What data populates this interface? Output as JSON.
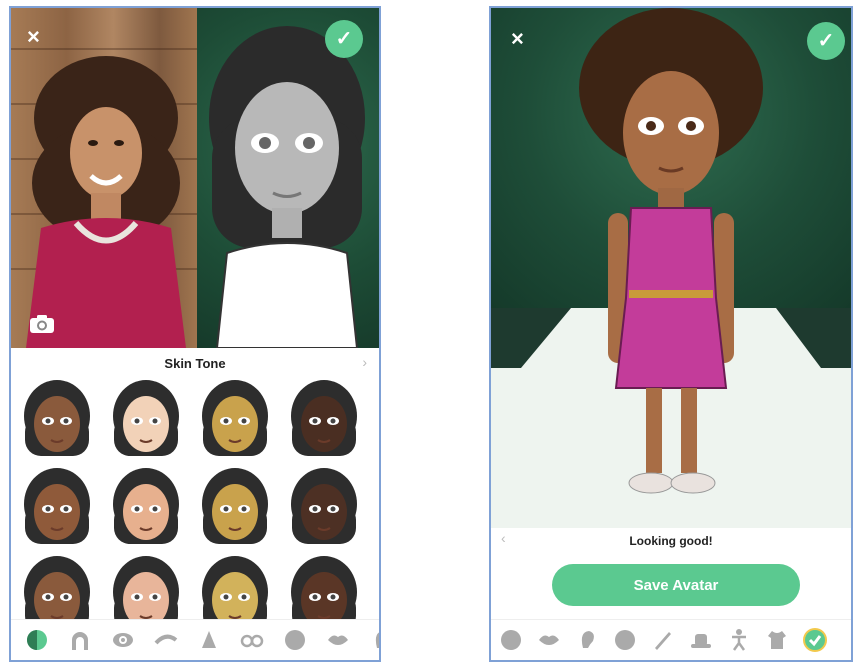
{
  "left_screen": {
    "close_glyph": "×",
    "confirm_glyph": "✓",
    "sheet_title": "Skin Tone",
    "sheet_next_glyph": "›",
    "skin_tones": [
      "#8a5a3c",
      "#f2d2b8",
      "#c9a24c",
      "#4a2e22",
      "#8f5a3a",
      "#e7b08e",
      "#c9a24c",
      "#4d3024",
      "#8a5a3c",
      "#e8b59a",
      "#d2b25b",
      "#5a3626"
    ],
    "bottom_icons": [
      "skin-tone-icon",
      "hair-icon",
      "eye-icon",
      "eyebrow-icon",
      "nose-icon",
      "glasses-icon",
      "face-shape-icon",
      "lips-icon",
      "ear-icon"
    ]
  },
  "right_screen": {
    "close_glyph": "×",
    "confirm_glyph": "✓",
    "prev_glyph": "‹",
    "message": "Looking good!",
    "save_label": "Save Avatar",
    "bottom_icons": [
      "face-icon",
      "lips-icon",
      "ear-icon",
      "face-shape-icon",
      "pencil-icon",
      "hat-icon",
      "body-icon",
      "outfit-icon",
      "done-check-icon"
    ]
  },
  "colors": {
    "accent_green": "#5bc990",
    "dress": "#c33c9a",
    "stage": "#1e4d38"
  }
}
